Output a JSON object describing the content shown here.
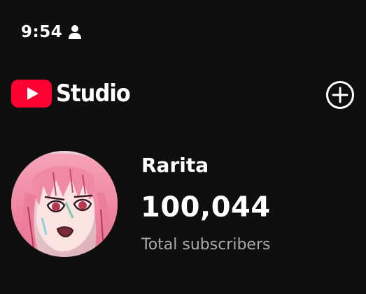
{
  "status_bar": {
    "time": "9:54",
    "icon": "person-icon"
  },
  "header": {
    "logo_icon": "youtube-logo-icon",
    "app_name": "Studio",
    "create_icon": "plus-circle-icon"
  },
  "channel": {
    "avatar_icon": "channel-avatar",
    "name": "Rarita",
    "subscriber_count": "100,044",
    "subscriber_label": "Total subscribers"
  },
  "colors": {
    "background": "#0f0f0f",
    "brand_red": "#ff0033",
    "text_primary": "#ffffff",
    "text_secondary": "#aaaaaa"
  }
}
